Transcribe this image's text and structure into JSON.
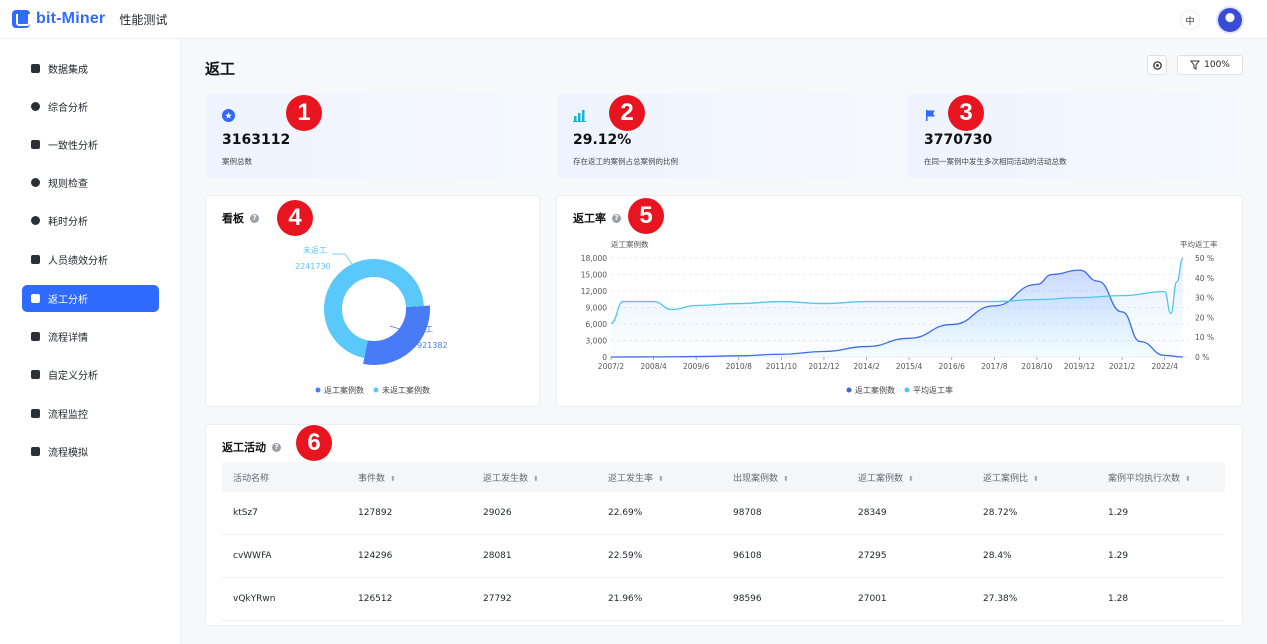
{
  "header": {
    "brand": "bit-Miner",
    "subtitle": "性能测试",
    "lang": "中"
  },
  "sidebar": {
    "items": [
      {
        "label": "数据集成",
        "icon": "layers-icon"
      },
      {
        "label": "综合分析",
        "icon": "pie-chart-icon"
      },
      {
        "label": "一致性分析",
        "icon": "columns-icon"
      },
      {
        "label": "规则检查",
        "icon": "trend-circle-icon"
      },
      {
        "label": "耗时分析",
        "icon": "clock-icon"
      },
      {
        "label": "人员绩效分析",
        "icon": "user-icon"
      },
      {
        "label": "返工分析",
        "icon": "rework-icon",
        "active": true
      },
      {
        "label": "流程详情",
        "icon": "flow-detail-icon"
      },
      {
        "label": "自定义分析",
        "icon": "bar-chart-icon"
      },
      {
        "label": "流程监控",
        "icon": "monitor-icon"
      },
      {
        "label": "流程模拟",
        "icon": "simulate-icon"
      }
    ]
  },
  "page": {
    "title": "返工",
    "filter_label": "100%"
  },
  "stats": [
    {
      "value": "3163112",
      "desc": "案例总数",
      "badge": "1",
      "icon": "star-circle-icon"
    },
    {
      "value": "29.12%",
      "desc": "存在返工的案例占总案例的比例",
      "badge": "2",
      "icon": "bar-signal-icon"
    },
    {
      "value": "3770730",
      "desc": "在同一案例中发生多次相同活动的活动总数",
      "badge": "3",
      "icon": "flag-icon"
    }
  ],
  "board": {
    "title": "看板",
    "badge": "4",
    "chart_data": {
      "type": "pie",
      "slices": [
        {
          "label": "未返工",
          "value": 2241730,
          "color": "#5ac8fa"
        },
        {
          "label": "返工",
          "value": 921382,
          "color": "#4a7bf7"
        }
      ],
      "legend": [
        "返工案例数",
        "未返工案例数"
      ],
      "legend_placement": "bottom"
    }
  },
  "rework_rate": {
    "title": "返工率",
    "badge": "5",
    "chart_data": {
      "type": "line",
      "y_left_label": "返工案例数",
      "y_right_label": "平均返工率",
      "ylim_left": [
        0,
        18000
      ],
      "ylim_right": [
        0,
        50
      ],
      "y_left_ticks": [
        "0",
        "3,000",
        "6,000",
        "9,000",
        "12,000",
        "15,000",
        "18,000"
      ],
      "y_right_ticks": [
        "0 %",
        "10 %",
        "20 %",
        "30 %",
        "40 %",
        "50 %"
      ],
      "x_ticks": [
        "2007/2",
        "2008/4",
        "2009/6",
        "2010/8",
        "2011/10",
        "2012/12",
        "2014/2",
        "2015/4",
        "2016/6",
        "2017/8",
        "2018/10",
        "2019/12",
        "2021/2",
        "2022/4"
      ],
      "legend": [
        "返工案例数",
        "平均返工率"
      ],
      "legend_placement": "bottom",
      "grid": true,
      "series": [
        {
          "name": "返工案例数",
          "axis": "left",
          "color": "#3d6be8",
          "x": [
            "2007/2",
            "2008/4",
            "2009/6",
            "2010/8",
            "2011/10",
            "2012/12",
            "2014/2",
            "2015/4",
            "2016/6",
            "2017/8",
            "2018/10",
            "2019/3",
            "2019/12",
            "2020/6",
            "2021/2",
            "2021/8",
            "2022/4",
            "2022/10"
          ],
          "values": [
            0,
            20,
            80,
            220,
            500,
            1000,
            1900,
            3400,
            5900,
            9300,
            13200,
            15000,
            15800,
            13800,
            8200,
            2800,
            300,
            0
          ]
        },
        {
          "name": "平均返工率",
          "axis": "right",
          "color": "#4cc7f0",
          "x": [
            "2007/2",
            "2007/6",
            "2008/4",
            "2008/10",
            "2009/6",
            "2010/8",
            "2011/10",
            "2012/12",
            "2014/2",
            "2015/4",
            "2016/6",
            "2017/8",
            "2018/10",
            "2019/12",
            "2021/2",
            "2022/4",
            "2022/6",
            "2022/8",
            "2022/10"
          ],
          "values": [
            17,
            28,
            28,
            24,
            26,
            27,
            28,
            27,
            28,
            28,
            28,
            28,
            29,
            30,
            31,
            33,
            22,
            38,
            50
          ]
        }
      ]
    }
  },
  "rework_activities": {
    "title": "返工活动",
    "badge": "6",
    "columns": [
      "活动名称",
      "事件数",
      "返工发生数",
      "返工发生率",
      "出现案例数",
      "返工案例数",
      "返工案例比",
      "案例平均执行次数"
    ],
    "rows": [
      [
        "ktSz7",
        "127892",
        "29026",
        "22.69%",
        "98708",
        "28349",
        "28.72%",
        "1.29"
      ],
      [
        "cvWWFA",
        "124296",
        "28081",
        "22.59%",
        "96108",
        "27295",
        "28.4%",
        "1.29"
      ],
      [
        "vQkYRwn",
        "126512",
        "27792",
        "21.96%",
        "98596",
        "27001",
        "27.38%",
        "1.28"
      ]
    ]
  }
}
